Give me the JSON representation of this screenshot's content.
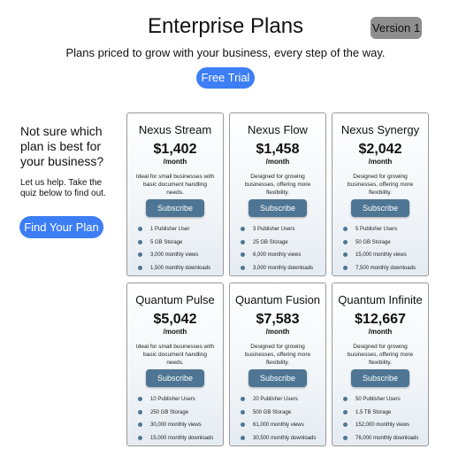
{
  "header": {
    "title": "Enterprise Plans",
    "version_badge": "Version 1",
    "subtitle": "Plans priced to grow with your business, every step of the way.",
    "trial_label": "Free Trial"
  },
  "side": {
    "question": "Not sure which plan is best for your business?",
    "help": "Let us help. Take the quiz below to find out.",
    "quiz_label": "Find Your Plan"
  },
  "plans": [
    {
      "name": "Nexus Stream",
      "price": "$1,402",
      "period": "/month",
      "desc": "Ideal for small businesses with basic document handling needs.",
      "button": "Subscribe",
      "features": [
        "1 Publisher User",
        "5 GB Storage",
        "3,000 monthly views",
        "1,500 monthly downloads"
      ]
    },
    {
      "name": "Nexus Flow",
      "price": "$1,458",
      "period": "/month",
      "desc": "Designed for growing businesses, offering more flexibility.",
      "button": "Subscribe",
      "features": [
        "3 Publisher Users",
        "25 GB Storage",
        "6,000 monthly views",
        "3,000 monthly downloads"
      ]
    },
    {
      "name": "Nexus Synergy",
      "price": "$2,042",
      "period": "/month",
      "desc": "Designed for growing businesses, offering more flexibility.",
      "button": "Subscribe",
      "features": [
        "5 Publisher Users",
        "50 GB Storage",
        "15,000 monthly views",
        "7,500 monthly downloads"
      ]
    },
    {
      "name": "Quantum Pulse",
      "price": "$5,042",
      "period": "/month",
      "desc": "Ideal for small businesses with basic document handling needs.",
      "button": "Subscribe",
      "features": [
        "10 Publisher Users",
        "250 GB Storage",
        "30,000 monthly views",
        "15,000 monthly downloads"
      ]
    },
    {
      "name": "Quantum Fusion",
      "price": "$7,583",
      "period": "/month",
      "desc": "Designed for growing businesses, offering more flexibility.",
      "button": "Subscribe",
      "features": [
        "20 Publisher Users",
        "500 GB Storage",
        "61,000 monthly views",
        "30,500 monthly downloads"
      ]
    },
    {
      "name": "Quantum Infinite",
      "price": "$12,667",
      "period": "/month",
      "desc": "Designed for growing businesses, offering more flexibility.",
      "button": "Subscribe",
      "features": [
        "50 Publisher Users",
        "1.5 TB Storage",
        "152,000 monthly views",
        "76,000 monthly downloads"
      ]
    }
  ],
  "colors": {
    "accent_blue": "#3d7ef5",
    "subscribe_blue": "#4e7694",
    "version_gray": "#8e8e8e"
  }
}
